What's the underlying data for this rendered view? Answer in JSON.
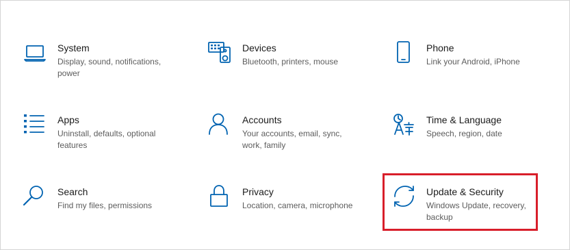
{
  "tiles": [
    {
      "id": "system",
      "title": "System",
      "desc": "Display, sound, notifications, power",
      "icon": "laptop-icon"
    },
    {
      "id": "devices",
      "title": "Devices",
      "desc": "Bluetooth, printers, mouse",
      "icon": "keyboard-speaker-icon"
    },
    {
      "id": "phone",
      "title": "Phone",
      "desc": "Link your Android, iPhone",
      "icon": "phone-icon"
    },
    {
      "id": "apps",
      "title": "Apps",
      "desc": "Uninstall, defaults, optional features",
      "icon": "list-icon"
    },
    {
      "id": "accounts",
      "title": "Accounts",
      "desc": "Your accounts, email, sync, work, family",
      "icon": "person-icon"
    },
    {
      "id": "time-language",
      "title": "Time & Language",
      "desc": "Speech, region, date",
      "icon": "language-icon"
    },
    {
      "id": "search",
      "title": "Search",
      "desc": "Find my files, permissions",
      "icon": "search-icon"
    },
    {
      "id": "privacy",
      "title": "Privacy",
      "desc": "Location, camera, microphone",
      "icon": "lock-icon"
    },
    {
      "id": "update-security",
      "title": "Update & Security",
      "desc": "Windows Update, recovery, backup",
      "icon": "sync-icon"
    }
  ],
  "colors": {
    "accent": "#0063b1",
    "highlight": "#d81e2a",
    "title": "#1a1a1a",
    "desc": "#5c5c5c"
  }
}
